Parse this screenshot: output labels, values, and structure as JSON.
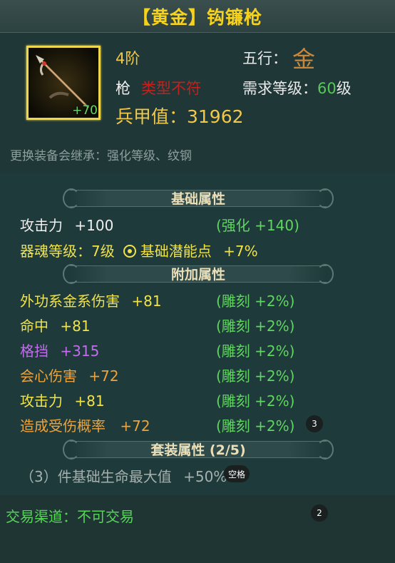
{
  "title": "【黄金】钩镰枪",
  "item": {
    "enhance": "+70",
    "grade": "4阶",
    "wuxing_label": "五行：",
    "wuxing_glyph": "金",
    "weapon_type": "枪",
    "type_warning": "类型不符",
    "req_label": "需求等级：",
    "req_value": "60",
    "req_unit": "级",
    "power": "兵甲值：31962",
    "inherit_note": "更换装备会继承：强化等级、纹钢"
  },
  "base": {
    "header": "基础属性",
    "attack_label": "攻击力",
    "attack_value": "+100",
    "attack_bonus": "(强化 +140)",
    "soul_label": "器魂等级：7级",
    "potential_label": "基础潜能点",
    "potential_value": "+7%"
  },
  "extra": {
    "header": "附加属性",
    "rows": [
      {
        "label": "外功系金系伤害",
        "value": "+81",
        "bonus": "(雕刻 +2%)"
      },
      {
        "label": "命中",
        "value": "+81",
        "bonus": "(雕刻 +2%)"
      },
      {
        "label": "格挡",
        "value": "+315",
        "bonus": "(雕刻 +2%)"
      },
      {
        "label": "会心伤害",
        "value": "+72",
        "bonus": "(雕刻 +2%)"
      },
      {
        "label": "攻击力",
        "value": "+81",
        "bonus": "(雕刻 +2%)"
      },
      {
        "label": "造成受伤概率",
        "value": "+72",
        "bonus": "(雕刻 +2%)"
      }
    ]
  },
  "set": {
    "header": "套装属性 (2/5)",
    "row_text": "（3）件基础生命最大值",
    "row_value": "+50%"
  },
  "trade": "交易渠道：不可交易",
  "overlays": {
    "badge_3": "3",
    "badge_2": "2",
    "tip_space": "空格"
  },
  "colors": {
    "title": "#f7d21c",
    "gold": "#f2c84a",
    "green": "#5fd65f",
    "yellow": "#f0e34a",
    "purple": "#c46bf0",
    "orange": "#eea33a",
    "red": "#c4201e"
  }
}
